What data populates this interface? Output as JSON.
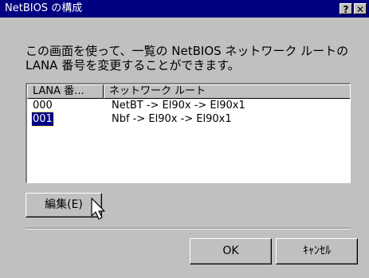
{
  "window": {
    "title": "NetBIOS の構成",
    "help_glyph": "?",
    "close_glyph": "✕"
  },
  "description": {
    "line1": "この画面を使って、一覧の NetBIOS ネットワーク ルートの",
    "line2": "LANA 番号を変更することができます。"
  },
  "list": {
    "headers": [
      "LANA 番...",
      "ネットワーク ルート"
    ],
    "rows": [
      {
        "lana": "000",
        "route": "NetBT -> El90x -> El90x1"
      },
      {
        "lana": "001",
        "route": "Nbf -> El90x -> El90x1",
        "selected": true
      }
    ]
  },
  "buttons": {
    "edit": "編集(E)",
    "ok": "OK",
    "cancel": "ｷｬﾝｾﾙ"
  },
  "cursor": {
    "icon": "arrow-cursor-icon"
  }
}
